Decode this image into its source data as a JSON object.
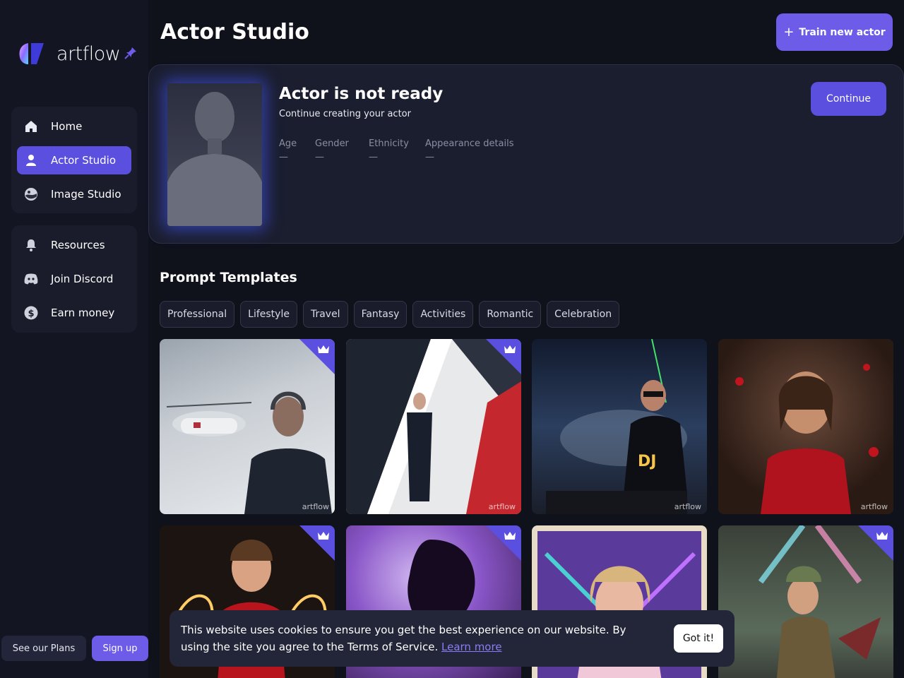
{
  "brand": {
    "name": "artflow"
  },
  "sidebar": {
    "primary": [
      {
        "label": "Home",
        "icon": "home-icon"
      },
      {
        "label": "Actor Studio",
        "icon": "user-icon",
        "active": true
      },
      {
        "label": "Image Studio",
        "icon": "image-icon"
      }
    ],
    "secondary": [
      {
        "label": "Resources",
        "icon": "bell-icon"
      },
      {
        "label": "Join Discord",
        "icon": "discord-icon"
      },
      {
        "label": "Earn money",
        "icon": "dollar-icon"
      }
    ],
    "plans_label": "See our Plans",
    "signup_label": "Sign up"
  },
  "header": {
    "title": "Actor Studio",
    "train_label": "Train new actor"
  },
  "actor": {
    "title": "Actor is not ready",
    "subtitle": "Continue creating your actor",
    "continue_label": "Continue",
    "attributes": [
      {
        "label": "Age",
        "value": "—"
      },
      {
        "label": "Gender",
        "value": "—"
      },
      {
        "label": "Ethnicity",
        "value": "—"
      },
      {
        "label": "Appearance details",
        "value": "—"
      }
    ]
  },
  "templates": {
    "title": "Prompt Templates",
    "categories": [
      "Professional",
      "Lifestyle",
      "Travel",
      "Fantasy",
      "Activities",
      "Romantic",
      "Celebration"
    ],
    "watermark": "artflow"
  },
  "cookie": {
    "text": "This website uses cookies to ensure you get the best experience on our website. By using the site you agree to the Terms of Service.",
    "link": "Learn more",
    "button": "Got it!"
  },
  "colors": {
    "accent": "#6c5ce7",
    "background": "#0f111b",
    "panel": "#1a1c2b"
  }
}
